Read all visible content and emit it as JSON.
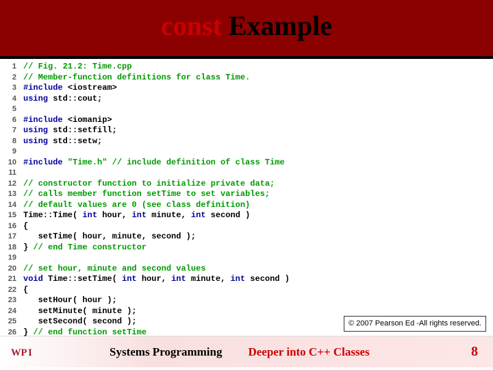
{
  "header": {
    "kw": "const",
    "rest": " Example"
  },
  "code": {
    "lines": [
      {
        "n": "1",
        "seg": [
          [
            "cm",
            "// Fig. 21.2: Time.cpp"
          ]
        ]
      },
      {
        "n": "2",
        "seg": [
          [
            "cm",
            "// Member-function definitions for class Time."
          ]
        ]
      },
      {
        "n": "3",
        "seg": [
          [
            "pp",
            "#include "
          ],
          [
            "plain",
            "<iostream>"
          ]
        ]
      },
      {
        "n": "4",
        "seg": [
          [
            "kw2",
            "using "
          ],
          [
            "plain",
            "std::cout;"
          ]
        ]
      },
      {
        "n": "5",
        "seg": []
      },
      {
        "n": "6",
        "seg": [
          [
            "pp",
            "#include "
          ],
          [
            "plain",
            "<iomanip>"
          ]
        ]
      },
      {
        "n": "7",
        "seg": [
          [
            "kw2",
            "using "
          ],
          [
            "plain",
            "std::setfill;"
          ]
        ]
      },
      {
        "n": "8",
        "seg": [
          [
            "kw2",
            "using "
          ],
          [
            "plain",
            "std::setw;"
          ]
        ]
      },
      {
        "n": "9",
        "seg": []
      },
      {
        "n": "10",
        "seg": [
          [
            "pp",
            "#include "
          ],
          [
            "st",
            "\"Time.h\""
          ],
          [
            "cm",
            " // include definition of class Time"
          ]
        ]
      },
      {
        "n": "11",
        "seg": []
      },
      {
        "n": "12",
        "seg": [
          [
            "cm",
            "// constructor function to initialize private data;"
          ]
        ]
      },
      {
        "n": "13",
        "seg": [
          [
            "cm",
            "// calls member function setTime to set variables;"
          ]
        ]
      },
      {
        "n": "14",
        "seg": [
          [
            "cm",
            "// default values are 0 (see class definition)"
          ]
        ]
      },
      {
        "n": "15",
        "seg": [
          [
            "plain",
            "Time::Time( "
          ],
          [
            "kw2",
            "int"
          ],
          [
            "plain",
            " hour, "
          ],
          [
            "kw2",
            "int"
          ],
          [
            "plain",
            " minute, "
          ],
          [
            "kw2",
            "int"
          ],
          [
            "plain",
            " second )"
          ]
        ]
      },
      {
        "n": "16",
        "seg": [
          [
            "plain",
            "{"
          ]
        ]
      },
      {
        "n": "17",
        "seg": [
          [
            "plain",
            "   setTime( hour, minute, second );"
          ]
        ]
      },
      {
        "n": "18",
        "seg": [
          [
            "plain",
            "} "
          ],
          [
            "cm",
            "// end Time constructor"
          ]
        ]
      },
      {
        "n": "19",
        "seg": []
      },
      {
        "n": "20",
        "seg": [
          [
            "cm",
            "// set hour, minute and second values"
          ]
        ]
      },
      {
        "n": "21",
        "seg": [
          [
            "kw2",
            "void"
          ],
          [
            "plain",
            " Time::setTime( "
          ],
          [
            "kw2",
            "int"
          ],
          [
            "plain",
            " hour, "
          ],
          [
            "kw2",
            "int"
          ],
          [
            "plain",
            " minute, "
          ],
          [
            "kw2",
            "int"
          ],
          [
            "plain",
            " second )"
          ]
        ]
      },
      {
        "n": "22",
        "seg": [
          [
            "plain",
            "{"
          ]
        ]
      },
      {
        "n": "23",
        "seg": [
          [
            "plain",
            "   setHour( hour );"
          ]
        ]
      },
      {
        "n": "24",
        "seg": [
          [
            "plain",
            "   setMinute( minute );"
          ]
        ]
      },
      {
        "n": "25",
        "seg": [
          [
            "plain",
            "   setSecond( second );"
          ]
        ]
      },
      {
        "n": "26",
        "seg": [
          [
            "plain",
            "} "
          ],
          [
            "cm",
            "// end function setTime"
          ]
        ]
      }
    ]
  },
  "copyright": "© 2007 Pearson Ed -All rights reserved.",
  "footer": {
    "left": "Systems Programming",
    "center": "Deeper into C++ Classes",
    "page": "8"
  }
}
